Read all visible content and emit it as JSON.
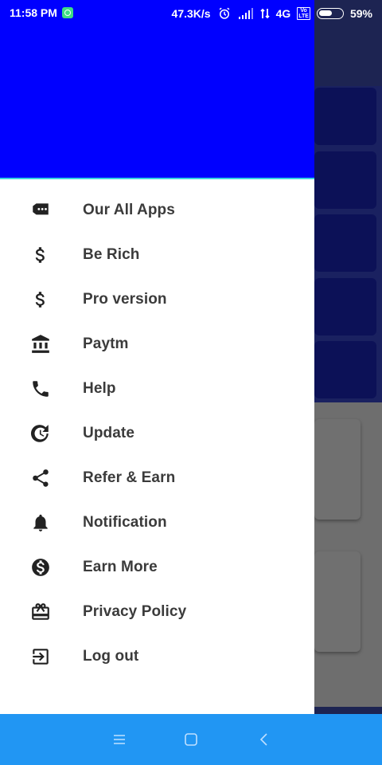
{
  "status_bar": {
    "time": "11:58 PM",
    "network_speed": "47.3K/s",
    "network_type": "4G",
    "volte_top": "Vo",
    "volte_bottom": "LTE",
    "battery_percent": "59%",
    "battery_level": 0.59,
    "icons": [
      "whatsapp-icon",
      "alarm-icon",
      "signal-icon",
      "data-arrows-icon",
      "battery-icon"
    ]
  },
  "drawer": {
    "header_color": "#0000ff",
    "accent_line_color": "#3ad1e0",
    "menu": [
      {
        "label": "Our All Apps",
        "icon": "apps-chat-icon"
      },
      {
        "label": "Be Rich",
        "icon": "dollar-icon"
      },
      {
        "label": "Pro version",
        "icon": "dollar-icon"
      },
      {
        "label": "Paytm",
        "icon": "bank-icon"
      },
      {
        "label": "Help",
        "icon": "phone-icon"
      },
      {
        "label": "Update",
        "icon": "update-icon"
      },
      {
        "label": "Refer & Earn",
        "icon": "share-icon"
      },
      {
        "label": "Notification",
        "icon": "bell-icon"
      },
      {
        "label": "Earn More",
        "icon": "dollar-circle-icon"
      },
      {
        "label": "Privacy Policy",
        "icon": "gift-card-icon"
      },
      {
        "label": "Log out",
        "icon": "logout-icon"
      }
    ]
  },
  "nav_bar": {
    "color": "#2196f3",
    "buttons": [
      "menu-icon",
      "home-icon",
      "back-icon"
    ]
  }
}
